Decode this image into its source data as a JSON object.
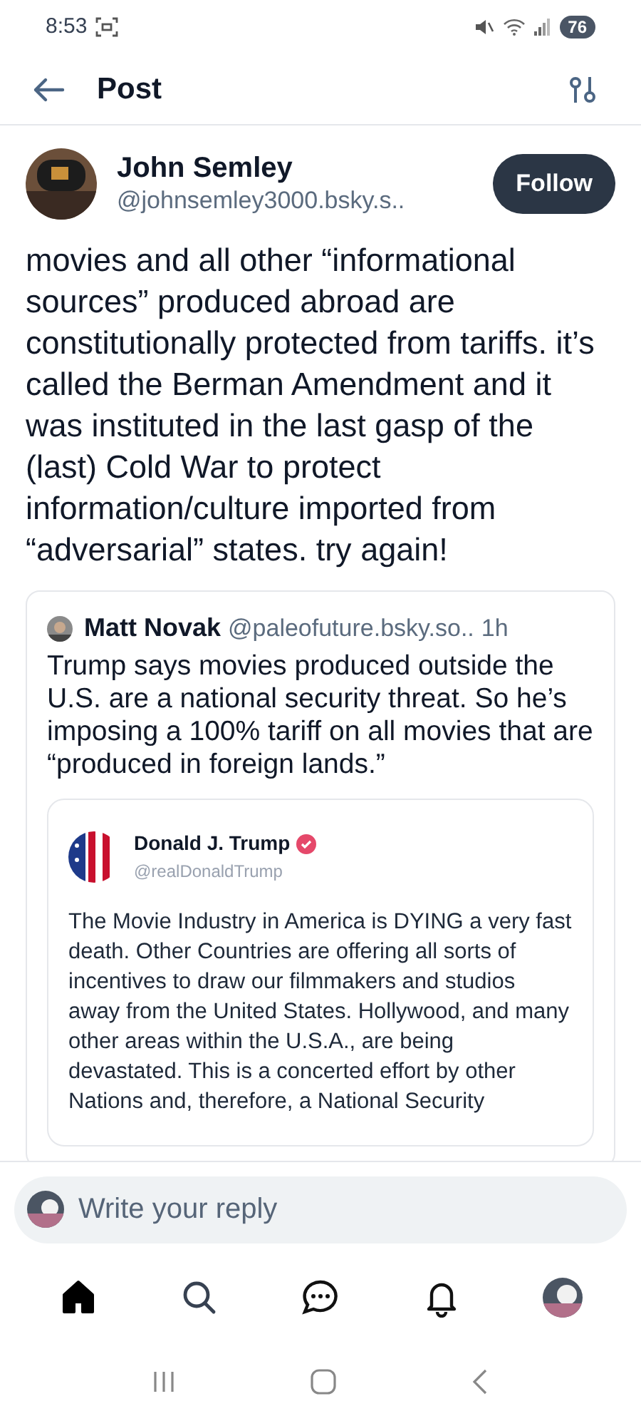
{
  "status_bar": {
    "time": "8:53",
    "battery": "76"
  },
  "header": {
    "title": "Post"
  },
  "post": {
    "author": "John Semley",
    "handle": "@johnsemley3000.bsky.s..",
    "follow_label": "Follow",
    "text": "movies and all other “informational sources” produced abroad are constitutionally protected from tariffs. it’s called the Berman Amendment and it was instituted in the last gasp of the (last) Cold War to protect information/culture imported from “adversarial” states. try again!",
    "quote": {
      "author": "Matt Novak",
      "handle": "@paleofuture.bsky.so..",
      "time": "1h",
      "text": "Trump says movies produced outside the U.S. are a national security threat. So he’s imposing a 100% tariff on all movies that are “produced in foreign lands.”",
      "embed": {
        "author": "Donald J. Trump",
        "verified": true,
        "handle": "@realDonaldTrump",
        "text": "The Movie Industry in America is DYING a very fast death. Other Countries are offering all sorts of incentives to draw our filmmakers and studios away from the United States. Hollywood, and many other areas within the U.S.A., are being devastated. This is a concerted effort by other Nations and, therefore, a National Security"
      }
    }
  },
  "reply": {
    "placeholder": "Write your reply"
  },
  "nav": [
    {
      "kind": "home",
      "selected": true
    },
    {
      "kind": "search",
      "selected": false
    },
    {
      "kind": "chat",
      "selected": false
    },
    {
      "kind": "bell",
      "selected": false
    },
    {
      "kind": "profile",
      "selected": false
    }
  ]
}
